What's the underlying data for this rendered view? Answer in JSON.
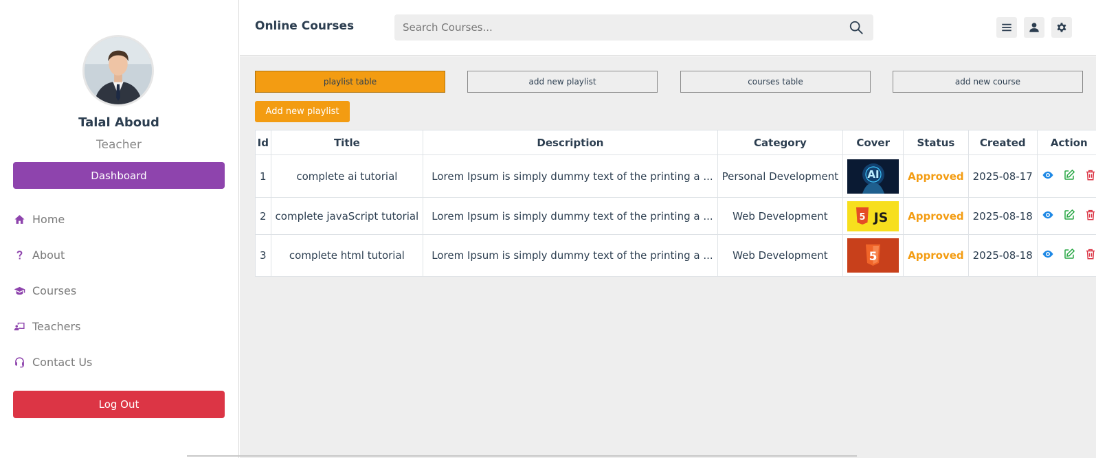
{
  "profile": {
    "name": "Talal Aboud",
    "role": "Teacher"
  },
  "sidebar": {
    "dashboard_label": "Dashboard",
    "items": [
      {
        "label": "Home",
        "icon": "home-icon"
      },
      {
        "label": "About",
        "icon": "question-icon"
      },
      {
        "label": "Courses",
        "icon": "graduation-cap-icon"
      },
      {
        "label": "Teachers",
        "icon": "chalkboard-teacher-icon"
      },
      {
        "label": "Contact Us",
        "icon": "headset-icon"
      }
    ],
    "logout_label": "Log Out"
  },
  "header": {
    "brand": "Online Courses",
    "search_placeholder": "Search Courses...",
    "icons": [
      "menu-icon",
      "user-icon",
      "settings-icon"
    ]
  },
  "main": {
    "tabs": [
      {
        "label": "playlist table",
        "active": true
      },
      {
        "label": "add new playlist",
        "active": false
      },
      {
        "label": "courses table",
        "active": false
      },
      {
        "label": "add new course",
        "active": false
      }
    ],
    "add_button_label": "Add new playlist",
    "table": {
      "columns": [
        "Id",
        "Title",
        "Description",
        "Category",
        "Cover",
        "Status",
        "Created",
        "Action"
      ],
      "rows": [
        {
          "id": "1",
          "title": "complete ai tutorial",
          "description": "Lorem Ipsum is simply dummy text of the printing a ...",
          "category": "Personal Development",
          "cover": "ai-cover-image",
          "status": "Approved",
          "created": "2025-08-17"
        },
        {
          "id": "2",
          "title": "complete javaScript tutorial",
          "description": "Lorem Ipsum is simply dummy text of the printing a ...",
          "category": "Web Development",
          "cover": "js-cover-image",
          "status": "Approved",
          "created": "2025-08-18"
        },
        {
          "id": "3",
          "title": "complete html tutorial",
          "description": "Lorem Ipsum is simply dummy text of the printing a ...",
          "category": "Web Development",
          "cover": "html5-cover-image",
          "status": "Approved",
          "created": "2025-08-18"
        }
      ],
      "cover_text": {
        "ai": "AI",
        "js": "JS",
        "html": "5"
      },
      "action_icons": [
        "eye-icon",
        "edit-icon",
        "trash-icon"
      ]
    }
  },
  "colors": {
    "accent": "#8e44ad",
    "orange": "#f39c12",
    "danger": "#dc3545",
    "view": "#1e88e5",
    "edit": "#28a745"
  }
}
